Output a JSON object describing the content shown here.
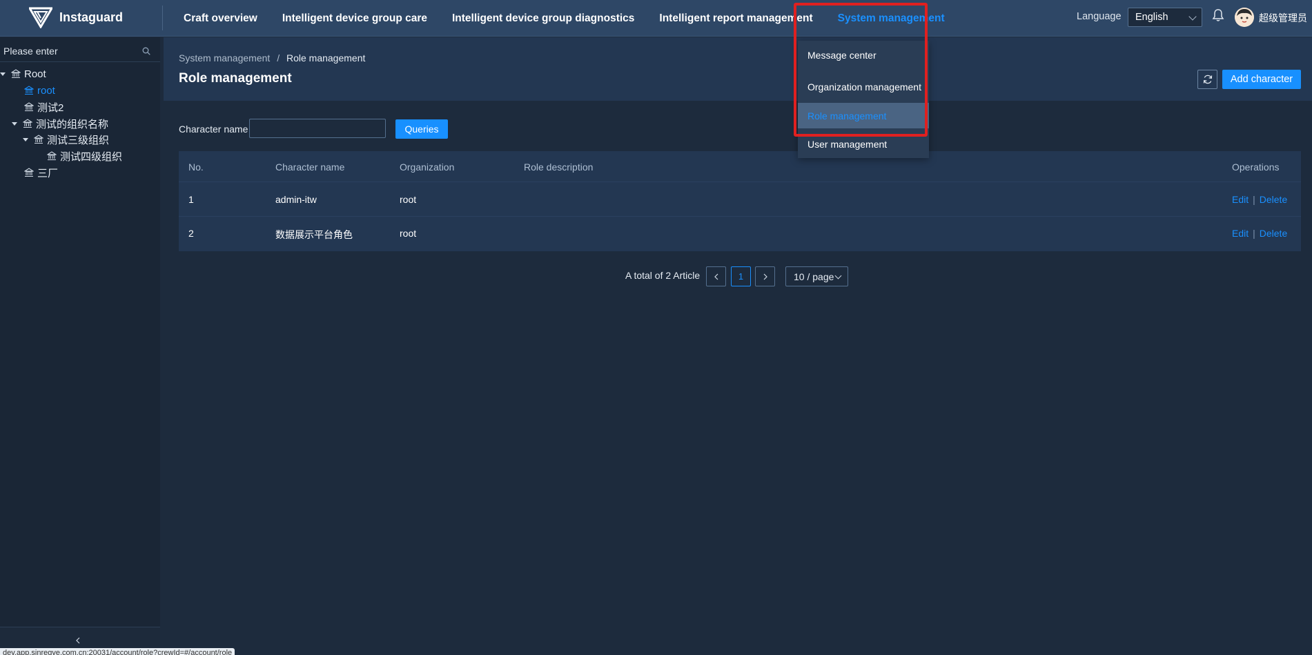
{
  "app": {
    "name": "Instaguard"
  },
  "nav": {
    "items": [
      "Craft overview",
      "Intelligent device group care",
      "Intelligent device group diagnostics",
      "Intelligent report management",
      "System management"
    ],
    "active": "System management"
  },
  "header": {
    "language_label": "Language",
    "language_value": "English",
    "username": "超级管理员"
  },
  "dropdown": {
    "items": [
      "Message center",
      "Organization management",
      "Role management",
      "User management"
    ],
    "active": "Role management"
  },
  "sidebar": {
    "search_placeholder": "Please enter",
    "tree": [
      "Root",
      "root",
      "测试2",
      "测试的组织名称",
      "测试三级组织",
      "测试四级组织",
      "三厂"
    ],
    "selected": "root"
  },
  "page": {
    "breadcrumb": {
      "parent": "System management",
      "separator": "/",
      "current": "Role management"
    },
    "title": "Role management",
    "add_button": "Add character"
  },
  "filter": {
    "label": "Character name",
    "value": "",
    "query_button": "Queries"
  },
  "table": {
    "columns": [
      "No.",
      "Character name",
      "Organization",
      "Role description",
      "Operations"
    ],
    "rows": [
      {
        "no": "1",
        "name": "admin-itw",
        "organization": "root",
        "description": "",
        "edit": "Edit",
        "delete": "Delete"
      },
      {
        "no": "2",
        "name": "数据展示平台角色",
        "organization": "root",
        "description": "",
        "edit": "Edit",
        "delete": "Delete"
      }
    ]
  },
  "pagination": {
    "total_text": "A total of 2 Article",
    "current_page": "1",
    "page_size": "10 / page"
  },
  "status_url": "dev.app.sinregve.com.cn:20031/account/role?crewId=#/account/role",
  "colors": {
    "accent": "#1890ff",
    "nav_bg": "#2e4766",
    "page_bg": "#1d2b3d",
    "highlight": "#e02020"
  }
}
